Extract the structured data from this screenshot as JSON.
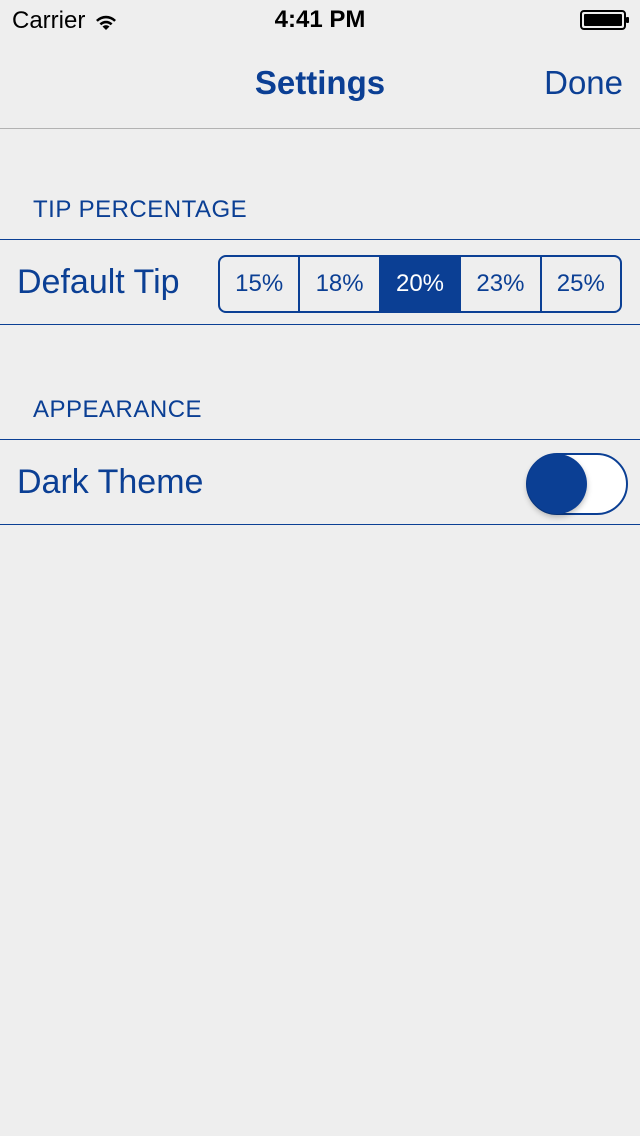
{
  "status_bar": {
    "carrier": "Carrier",
    "time": "4:41 PM",
    "icons": [
      "wifi-icon",
      "battery-icon"
    ]
  },
  "nav": {
    "title": "Settings",
    "done_label": "Done"
  },
  "sections": [
    {
      "header": "TIP PERCENTAGE",
      "cell": {
        "label": "Default Tip",
        "segments": [
          "15%",
          "18%",
          "20%",
          "23%",
          "25%"
        ],
        "selected": "20%"
      }
    },
    {
      "header": "APPEARANCE",
      "cell": {
        "label": "Dark Theme",
        "toggle_on": false
      }
    }
  ],
  "colors": {
    "accent": "#0b3f94",
    "background": "#eeeeee",
    "separator": "#b2b2b2"
  }
}
